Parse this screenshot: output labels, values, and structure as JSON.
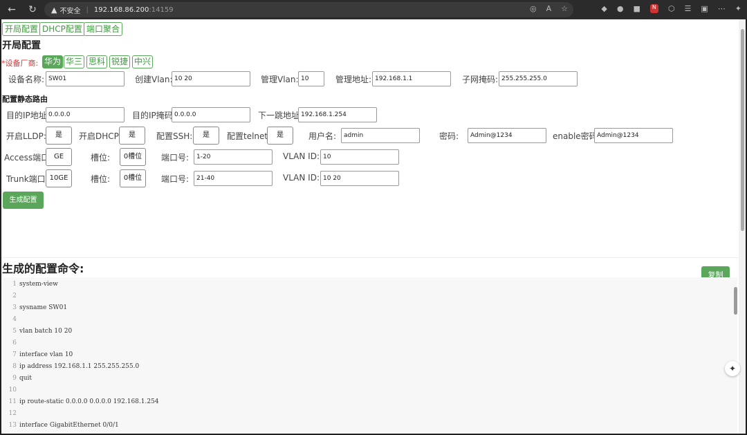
{
  "browser": {
    "warning_text": "不安全",
    "host": "192.168.86.200",
    "port": ":14159"
  },
  "tabs": [
    "开局配置",
    "DHCP配置",
    "端口聚合"
  ],
  "title": "开局配置",
  "vendor": {
    "label": "*设备厂商:",
    "options": [
      "华为",
      "华三",
      "思科",
      "锐捷",
      "中兴"
    ],
    "selected": "华为"
  },
  "row1": {
    "device_name_label": "设备名称:",
    "device_name": "SW01",
    "create_vlan_label": "创建Vlan:",
    "create_vlan": "10 20",
    "mgmt_vlan_label": "管理Vlan:",
    "mgmt_vlan": "10",
    "mgmt_addr_label": "管理地址:",
    "mgmt_addr": "192.168.1.1",
    "mask_label": "子网掩码:",
    "mask": "255.255.255.0"
  },
  "static_route_title": "配置静态路由",
  "route": {
    "dest_ip_label": "目的IP地址",
    "dest_ip": "0.0.0.0",
    "dest_mask_label": "目的IP掩码",
    "dest_mask": "0.0.0.0",
    "next_hop_label": "下一跳地址",
    "next_hop": "192.168.1.254"
  },
  "services": {
    "lldp_label": "开启LLDP:",
    "lldp": "是",
    "dhcp_label": "开启DHCP:",
    "dhcp": "是",
    "ssh_label": "配置SSH:",
    "ssh": "是",
    "telnet_label": "配置telnet:",
    "telnet": "是",
    "user_label": "用户名:",
    "user": "admin",
    "pwd_label": "密码:",
    "pwd": "Admin@1234",
    "enable_label": "enable密码",
    "enable": "Admin@1234"
  },
  "access": {
    "port_label": "Access端口",
    "port_type": "GE",
    "slot_label": "槽位:",
    "slot": "0槽位",
    "portno_label": "端口号:",
    "portno": "1-20",
    "vlan_label": "VLAN ID:",
    "vlan": "10"
  },
  "trunk": {
    "port_label": "Trunk端口",
    "port_type": "10GE",
    "slot_label": "槽位:",
    "slot": "0槽位",
    "portno_label": "端口号:",
    "portno": "21-40",
    "vlan_label": "VLAN ID:",
    "vlan": "10 20"
  },
  "generate_label": "生成配置",
  "output_title": "生成的配置命令:",
  "copy_label": "复制",
  "code_lines": [
    {
      "n": "1",
      "t": "system-view"
    },
    {
      "n": "2",
      "t": ""
    },
    {
      "n": "3",
      "t": "sysname SW01"
    },
    {
      "n": "4",
      "t": ""
    },
    {
      "n": "5",
      "t": "vlan batch 10 20"
    },
    {
      "n": "6",
      "t": ""
    },
    {
      "n": "7",
      "t": "interface vlan 10"
    },
    {
      "n": "8",
      "t": "ip address 192.168.1.1 255.255.255.0"
    },
    {
      "n": "9",
      "t": "quit"
    },
    {
      "n": "10",
      "t": ""
    },
    {
      "n": "11",
      "t": "ip route-static 0.0.0.0 0.0.0.0 192.168.1.254"
    },
    {
      "n": "12",
      "t": ""
    },
    {
      "n": "13",
      "t": "interface GigabitEthernet 0/0/1"
    }
  ]
}
